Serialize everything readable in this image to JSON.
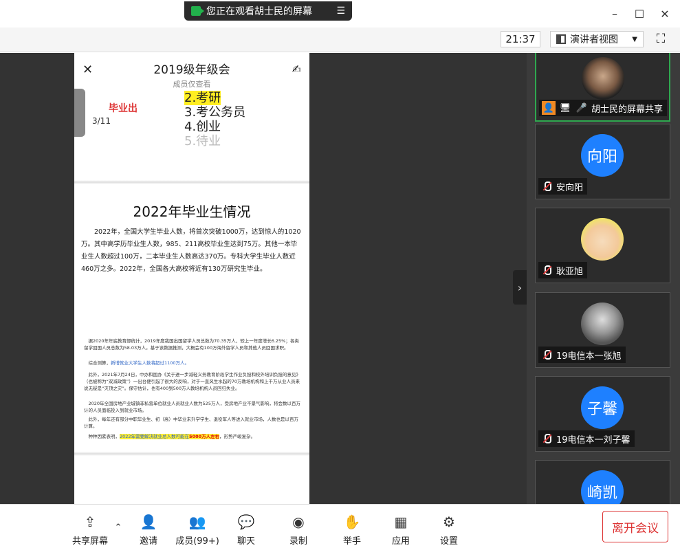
{
  "banner": {
    "text": "您正在观看胡士民的屏幕",
    "menu_icon": "list-menu-icon"
  },
  "window": {
    "minimize": "–",
    "maximize": "☐",
    "close": "✕"
  },
  "topbar": {
    "clock": "21:37",
    "view_mode": "演讲者视图",
    "fullscreen_icon": "expand-icon"
  },
  "doc": {
    "title": "2019级年级会",
    "subtitle": "成员仅查看",
    "page": "3/11",
    "side_label": "毕业出",
    "side_label2": "：",
    "list": [
      "2.考研",
      "3.考公务员",
      "4.创业",
      "5.待业"
    ],
    "section_title": "2022年毕业生情况",
    "paragraph": "2022年，全国大学生毕业人数，将首次突破1000万，达到惊人的1020万。其中高学历毕业生人数，985、211高校毕业生达到75万。其他一本毕业生人数超过100万，二本毕业生人数高达370万。专科大学生毕业人数近460万之多。2022年，全国各大高校将近有130万研究生毕业。",
    "small1": "据2020年年底教育部统计，2019年度我国出国留学人员总数为70.35万人，较上一年度增长6.25%；各类留学回国人员总数为58.03万人。基于该数据推测，大概会有100万海外留学人员和其他人员回国求职。",
    "small2a": "综合测算，",
    "small2b": "新增就业大学生人数将超过1100万人。",
    "small3": "此外，2021年7月24日，中办和国办《关于进一步减轻义务教育阶段学生作业负担和校外培训负担的意见》（也被称为“双减政策”）一出台便引起了很大的反响，对于一直风生水起的70万教培机构和上千万从业人员来说无疑是“灭顶之灾”。保守估计，也有400到500万人教培机构人员回归失业。",
    "small4": "2020年全国房地产业城镇非私营单位就业人员就业人数为525万人，受房地产业不景气影响，将会数以百万计的人员面临投入到就业市场。",
    "small5": "此外，每年还有部分中职毕业生、初（高）中毕业未升学学生、退役军人等进入就业市场，人数也是以百万计算。",
    "small6a": "种种因素表明，",
    "small6b": "2022年需要解决就业总人数可能在",
    "small6c": "5000万人左右",
    "small6d": "，形势严峻复杂。"
  },
  "participants": [
    {
      "name": "胡士民的屏幕共享",
      "avatar_text": "",
      "type": "photo1",
      "active": true,
      "icons": [
        "person-icon",
        "screen-share-icon",
        "mic-icon"
      ]
    },
    {
      "name": "安向阳",
      "avatar_text": "向阳",
      "type": "blue",
      "active": false
    },
    {
      "name": "耿亚旭",
      "avatar_text": "",
      "type": "cartoon",
      "active": false
    },
    {
      "name": "19电信本一张旭",
      "avatar_text": "",
      "type": "photo2",
      "active": false
    },
    {
      "name": "19电信本一刘子馨",
      "avatar_text": "子馨",
      "type": "blue",
      "active": false
    },
    {
      "name": "",
      "avatar_text": "崎凯",
      "type": "blue",
      "active": false
    }
  ],
  "toolbar": {
    "share": "共享屏幕",
    "invite": "邀请",
    "members": "成员(99+)",
    "chat": "聊天",
    "record": "录制",
    "raise": "举手",
    "apps": "应用",
    "settings": "设置",
    "leave": "离开会议"
  },
  "colors": {
    "accent_green": "#2fa84f",
    "leave_red": "#d33333",
    "avatar_blue": "#1e80ff",
    "highlight": "#ffee22"
  }
}
